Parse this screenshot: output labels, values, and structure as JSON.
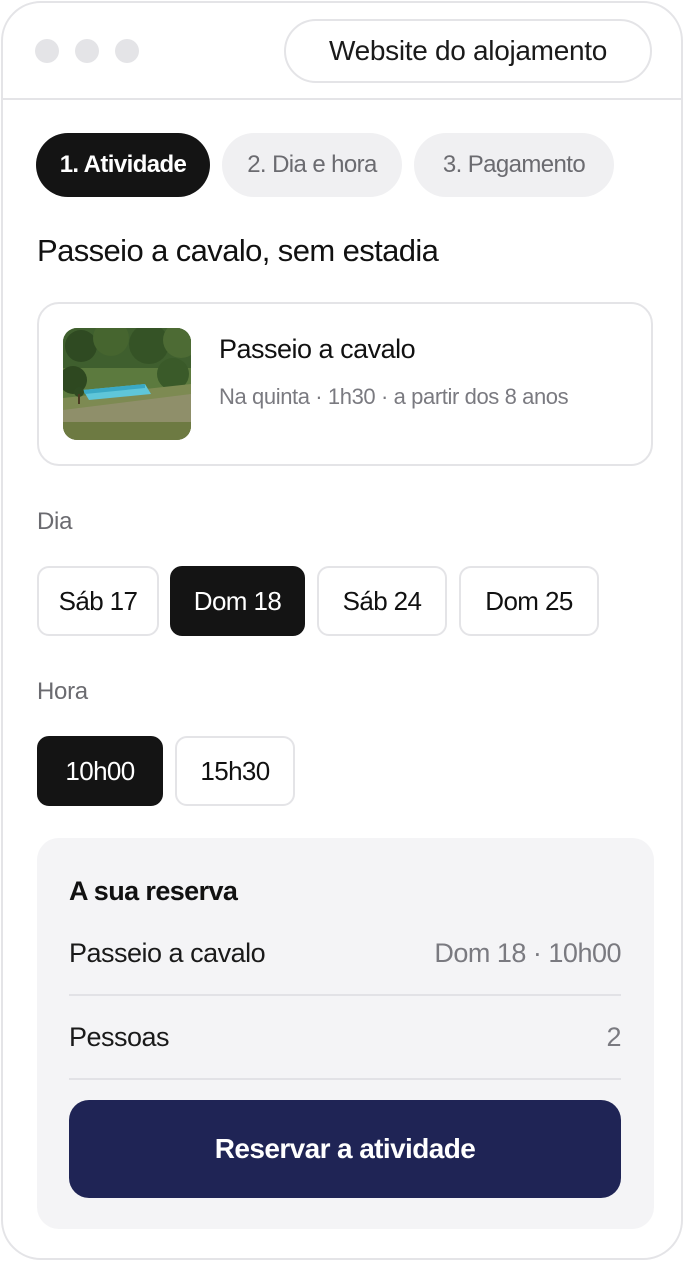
{
  "window": {
    "site_button_label": "Website do alojamento"
  },
  "steps": [
    {
      "label": "1. Atividade",
      "active": true
    },
    {
      "label": "2. Dia e hora",
      "active": false
    },
    {
      "label": "3. Pagamento",
      "active": false
    }
  ],
  "page_title": "Passeio a cavalo, sem estadia",
  "activity": {
    "title": "Passeio a cavalo",
    "subtitle": "Na quinta · 1h30 · a partir dos 8 anos",
    "image_icon": "landscape-pool-photo"
  },
  "day": {
    "label": "Dia",
    "options": [
      {
        "label": "Sáb 17",
        "selected": false
      },
      {
        "label": "Dom 18",
        "selected": true
      },
      {
        "label": "Sáb 24",
        "selected": false
      },
      {
        "label": "Dom 25",
        "selected": false
      }
    ]
  },
  "hour": {
    "label": "Hora",
    "options": [
      {
        "label": "10h00",
        "selected": true
      },
      {
        "label": "15h30",
        "selected": false
      }
    ]
  },
  "summary": {
    "title": "A sua reserva",
    "rows": [
      {
        "label": "Passeio a cavalo",
        "value": "Dom 18 · 10h00"
      },
      {
        "label": "Pessoas",
        "value": "2"
      }
    ],
    "cta_label": "Reservar a atividade"
  },
  "colors": {
    "primary_dark": "#141414",
    "cta_navy": "#1f2455",
    "border": "#e4e4e7",
    "muted_text": "#7a7a80"
  }
}
